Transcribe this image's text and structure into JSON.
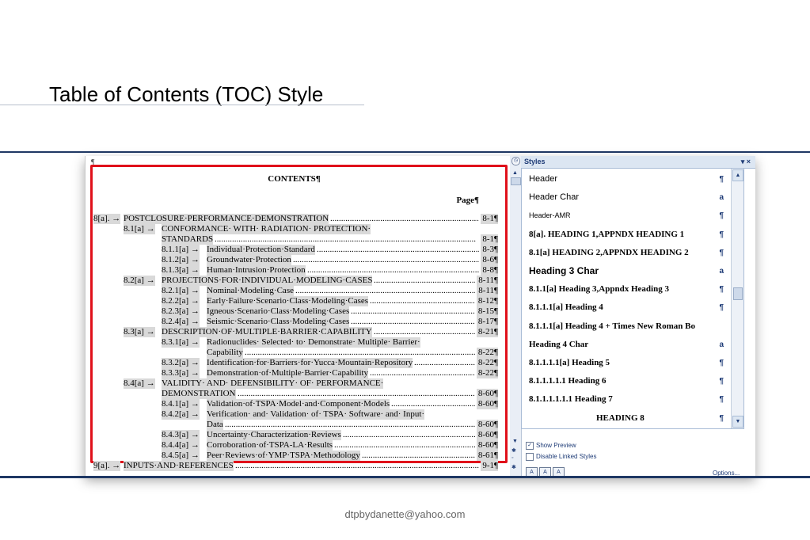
{
  "slide": {
    "title": "Table of Contents (TOC) Style",
    "footer_email": "dtpbydanette@yahoo.com"
  },
  "document": {
    "pilcrow": "¶",
    "heading": "CONTENTS¶",
    "page_label": "Page¶",
    "toc": [
      {
        "num": "8[a]. →",
        "text": "POSTCLOSURE·PERFORMANCE·DEMONSTRATION",
        "page": "8-1¶",
        "level": 0,
        "dots": true
      },
      {
        "num": "8.1[a] →",
        "text": "CONFORMANCE· WITH· RADIATION· PROTECTION·",
        "page": "",
        "level": 1,
        "dots": false
      },
      {
        "num": "",
        "text": "STANDARDS",
        "page": "8-1¶",
        "level": 1,
        "dots": true,
        "cont": true
      },
      {
        "num": "8.1.1[a] →",
        "text": "Individual·Protection·Standard",
        "page": "8-3¶",
        "level": 2,
        "dots": true
      },
      {
        "num": "8.1.2[a] →",
        "text": "Groundwater·Protection",
        "page": "8-6¶",
        "level": 2,
        "dots": true
      },
      {
        "num": "8.1.3[a] →",
        "text": "Human·Intrusion·Protection",
        "page": "8-8¶",
        "level": 2,
        "dots": true
      },
      {
        "num": "8.2[a] →",
        "text": "PROJECTIONS·FOR·INDIVIDUAL·MODELING·CASES",
        "page": "8-11¶",
        "level": 1,
        "dots": true
      },
      {
        "num": "8.2.1[a] →",
        "text": "Nominal·Modeling·Case",
        "page": "8-11¶",
        "level": 2,
        "dots": true
      },
      {
        "num": "8.2.2[a] →",
        "text": "Early·Failure·Scenario·Class·Modeling·Cases",
        "page": "8-12¶",
        "level": 2,
        "dots": true
      },
      {
        "num": "8.2.3[a] →",
        "text": "Igneous·Scenario·Class·Modeling·Cases",
        "page": "8-15¶",
        "level": 2,
        "dots": true
      },
      {
        "num": "8.2.4[a] →",
        "text": "Seismic·Scenario·Class·Modeling·Cases",
        "page": "8-17¶",
        "level": 2,
        "dots": true
      },
      {
        "num": "8.3[a] →",
        "text": "DESCRIPTION·OF·MULTIPLE·BARRIER·CAPABILITY",
        "page": "8-21¶",
        "level": 1,
        "dots": true
      },
      {
        "num": "8.3.1[a] →",
        "text": "Radionuclides· Selected· to· Demonstrate· Multiple· Barrier·",
        "page": "",
        "level": 2,
        "dots": false
      },
      {
        "num": "",
        "text": "Capability",
        "page": "8-22¶",
        "level": 2,
        "dots": true,
        "cont": true
      },
      {
        "num": "8.3.2[a] →",
        "text": "Identification·for·Barriers·for·Yucca·Mountain·Repository",
        "page": "8-22¶",
        "level": 2,
        "dots": true
      },
      {
        "num": "8.3.3[a] →",
        "text": "Demonstration·of·Multiple·Barrier·Capability",
        "page": "8-22¶",
        "level": 2,
        "dots": true
      },
      {
        "num": "8.4[a] →",
        "text": "VALIDITY· AND· DEFENSIBILITY· OF· PERFORMANCE·",
        "page": "",
        "level": 1,
        "dots": false
      },
      {
        "num": "",
        "text": "DEMONSTRATION",
        "page": "8-60¶",
        "level": 1,
        "dots": true,
        "cont": true
      },
      {
        "num": "8.4.1[a] →",
        "text": "Validation·of·TSPA·Model·and·Component·Models",
        "page": "8-60¶",
        "level": 2,
        "dots": true
      },
      {
        "num": "8.4.2[a] →",
        "text": "Verification· and· Validation· of· TSPA· Software· and· Input·",
        "page": "",
        "level": 2,
        "dots": false
      },
      {
        "num": "",
        "text": "Data",
        "page": "8-60¶",
        "level": 2,
        "dots": true,
        "cont": true
      },
      {
        "num": "8.4.3[a] →",
        "text": "Uncertainty·Characterization·Reviews",
        "page": "8-60¶",
        "level": 2,
        "dots": true
      },
      {
        "num": "8.4.4[a] →",
        "text": "Corroboration·of·TSPA-LA·Results",
        "page": "8-60¶",
        "level": 2,
        "dots": true
      },
      {
        "num": "8.4.5[a] →",
        "text": "Peer·Reviews·of·YMP·TSPA·Methodology",
        "page": "8-61¶",
        "level": 2,
        "dots": true
      },
      {
        "num": "9[a]. →",
        "text": "INPUTS·AND·REFERENCES",
        "page": "9-1¶",
        "level": 0,
        "dots": true
      }
    ]
  },
  "styles_pane": {
    "title": "Styles",
    "controls": "▾ ×",
    "items": [
      {
        "name": "Header",
        "mark": "¶",
        "style": "normal"
      },
      {
        "name": "Header Char",
        "mark": "a",
        "style": "normal"
      },
      {
        "name": "Header-AMR",
        "mark": "¶",
        "style": "small"
      },
      {
        "name": "8[a].  HEADING 1,APPNDX HEADING 1",
        "mark": "¶",
        "style": "bold-serif"
      },
      {
        "name": "8.1[a]  HEADING 2,APPNDX HEADING 2",
        "mark": "¶",
        "style": "bold-serif"
      },
      {
        "name": "Heading 3 Char",
        "mark": "a",
        "style": "bold-sans"
      },
      {
        "name": "8.1.1[a]  Heading 3,Appndx Heading 3",
        "mark": "¶",
        "style": "bold-serif"
      },
      {
        "name": "8.1.1.1[a]  Heading 4",
        "mark": "¶",
        "style": "bold-serif"
      },
      {
        "name": "8.1.1.1[a]  Heading 4 + Times New Roman Bo",
        "mark": "",
        "style": "bold-serif"
      },
      {
        "name": "Heading 4 Char",
        "mark": "a",
        "style": "bold-serif"
      },
      {
        "name": "8.1.1.1.1[a]  Heading 5",
        "mark": "¶",
        "style": "bold-serif"
      },
      {
        "name": "8.1.1.1.1.1  Heading 6",
        "mark": "¶",
        "style": "bold-serif"
      },
      {
        "name": "8.1.1.1.1.1.1  Heading 7",
        "mark": "¶",
        "style": "bold-serif"
      },
      {
        "name": "HEADING 8",
        "mark": "¶",
        "style": "bold-serif-center"
      }
    ],
    "show_preview": "Show Preview",
    "disable_linked": "Disable Linked Styles",
    "options": "Options..."
  }
}
